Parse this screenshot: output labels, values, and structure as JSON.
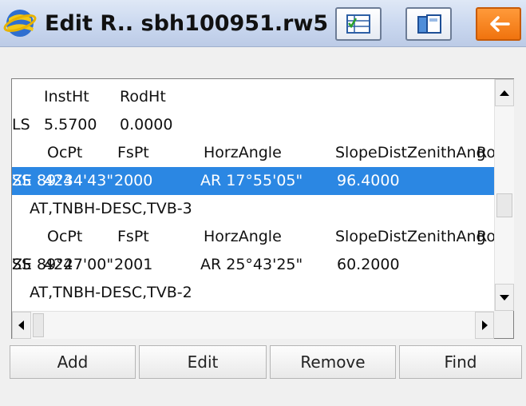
{
  "window": {
    "title": "Edit R.. sbh100951.rw5",
    "icons": {
      "app": "globe-app-icon",
      "table": "table-checkbox-icon",
      "file": "file-copy-icon",
      "back": "back-arrow-icon"
    },
    "back_button_color": "#f47f1b"
  },
  "list": {
    "selected_color": "#2b87e3",
    "rows": [
      {
        "type": "header",
        "cols": [
          "InstHt",
          "RodHt"
        ]
      },
      {
        "type": "record",
        "code": "LS",
        "cols": [
          "5.5700",
          "0.0000"
        ]
      },
      {
        "type": "header",
        "cols": [
          "OcPt",
          "FsPt",
          "HorzAngle",
          "SlopeDist",
          "ZenithAng",
          "Ro"
        ]
      },
      {
        "type": "record",
        "selected": true,
        "code": "SS",
        "cols": [
          "424",
          "2000",
          "AR 17°55'05\"",
          "96.4000",
          "ZE 89°34'43\""
        ]
      },
      {
        "type": "note",
        "text": "AT,TNBH-DESC,TVB-3"
      },
      {
        "type": "header",
        "cols": [
          "OcPt",
          "FsPt",
          "HorzAngle",
          "SlopeDist",
          "ZenithAng",
          "Ro"
        ]
      },
      {
        "type": "record",
        "code": "SS",
        "cols": [
          "424",
          "2001",
          "AR 25°43'25\"",
          "60.2000",
          "ZE 89°27'00\""
        ]
      },
      {
        "type": "note",
        "text": "AT,TNBH-DESC,TVB-2"
      }
    ]
  },
  "buttons": {
    "add": "Add",
    "edit": "Edit",
    "remove": "Remove",
    "find": "Find"
  }
}
